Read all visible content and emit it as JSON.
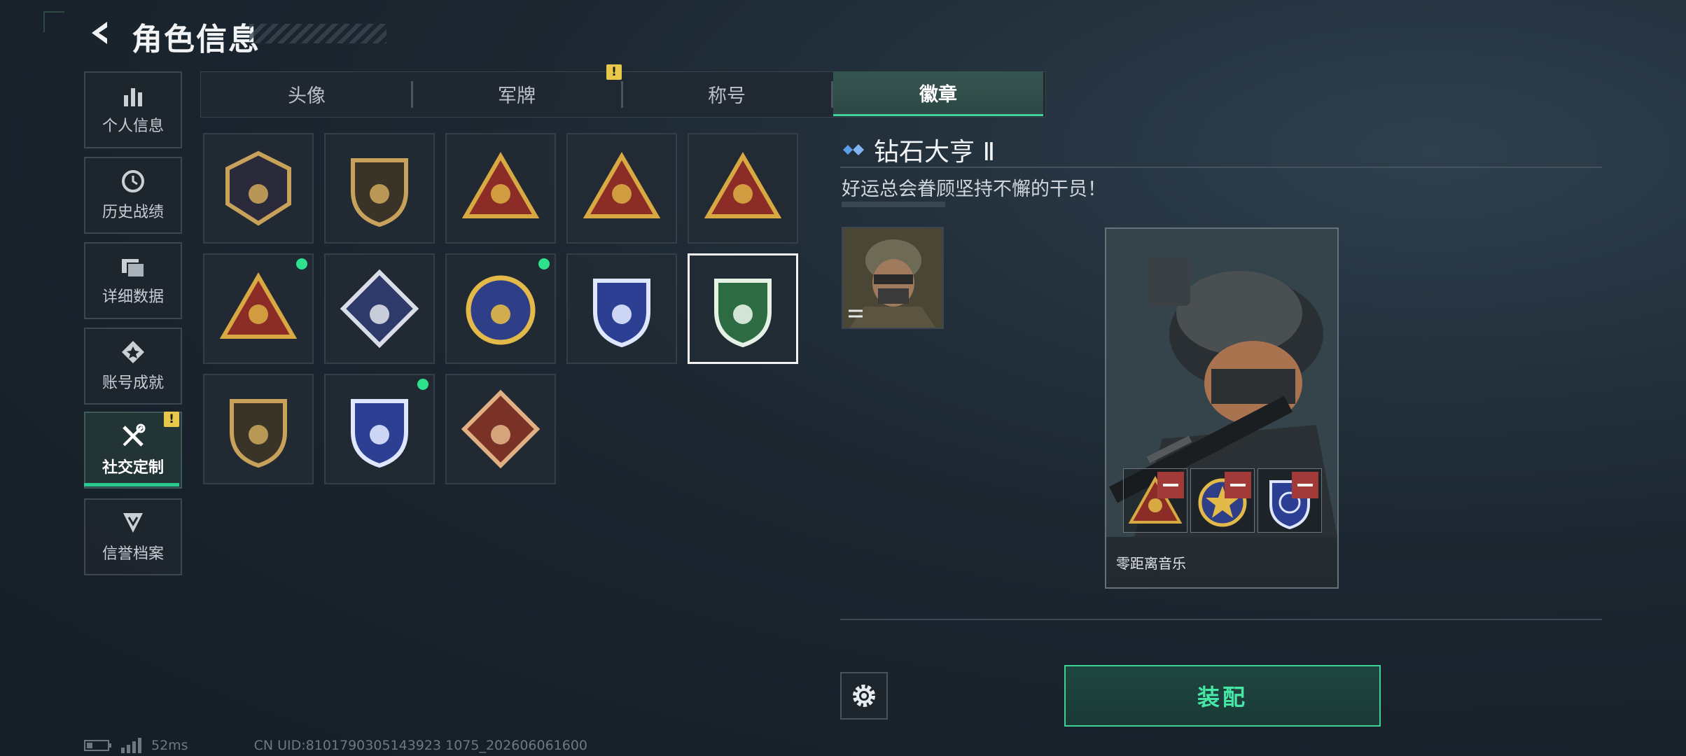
{
  "header": {
    "title": "角色信息"
  },
  "sidebar": {
    "items": [
      {
        "label": "个人信息",
        "icon": "bar-chart-icon"
      },
      {
        "label": "历史战绩",
        "icon": "clock-icon"
      },
      {
        "label": "详细数据",
        "icon": "folder-icon"
      },
      {
        "label": "账号成就",
        "icon": "achievement-icon"
      },
      {
        "label": "社交定制",
        "icon": "tools-icon",
        "active": true,
        "badge": "!"
      },
      {
        "label": "信誉档案",
        "icon": "shield-chevron-icon"
      }
    ]
  },
  "tabs": [
    {
      "label": "头像"
    },
    {
      "label": "军牌",
      "badge": "!"
    },
    {
      "label": "称号"
    },
    {
      "label": "徽章",
      "active": true
    }
  ],
  "badges": [
    {
      "name": "hexagon-triangle-badge",
      "color": "#c8a25a",
      "bg": "#2b2a3a",
      "new": false
    },
    {
      "name": "helicopter-badge",
      "color": "#c8a25a",
      "bg": "#3a3428",
      "new": false
    },
    {
      "name": "bomb-59-badge",
      "color": "#d8a842",
      "bg": "#8b2d26",
      "new": false
    },
    {
      "name": "number-1-triangle-badge",
      "color": "#d8a842",
      "bg": "#8b2d26",
      "new": false
    },
    {
      "name": "dice-triangle-badge",
      "color": "#d8a842",
      "bg": "#8b2d26",
      "new": false
    },
    {
      "name": "soldiers-triangle-badge",
      "color": "#d8a842",
      "bg": "#8b2d26",
      "new": true
    },
    {
      "name": "rose-diamond-badge",
      "color": "#dadde6",
      "bg": "#2d3a6a",
      "new": false
    },
    {
      "name": "star-circle-badge",
      "color": "#e3b94a",
      "bg": "#2e3f87",
      "new": true
    },
    {
      "name": "blue-shield-badge",
      "color": "#dfe6ff",
      "bg": "#2c3f93",
      "new": false
    },
    {
      "name": "green-gem-badge",
      "color": "#e6f1e6",
      "bg": "#2d6b42",
      "new": false,
      "selected": true
    },
    {
      "name": "rifle-shield-badge",
      "color": "#c8a25a",
      "bg": "#3a3428",
      "new": false
    },
    {
      "name": "crosshair-shield-badge",
      "color": "#dfe6ff",
      "bg": "#2c3f93",
      "new": true
    },
    {
      "name": "dragon-diamond-badge",
      "color": "#e0b084",
      "bg": "#7a3227",
      "new": false
    }
  ],
  "detail": {
    "title": "钻石大亨 Ⅱ",
    "description": "好运总会眷顾坚持不懈的干员！",
    "card_name": "零距离音乐",
    "equip_label": "装配"
  },
  "status": {
    "ping": "52ms",
    "uid": "CN UID:8101790305143923 1075_202606061600"
  },
  "colors": {
    "accent": "#3fd3a0",
    "warning": "#e8c84a",
    "remove": "#a33a3a"
  }
}
